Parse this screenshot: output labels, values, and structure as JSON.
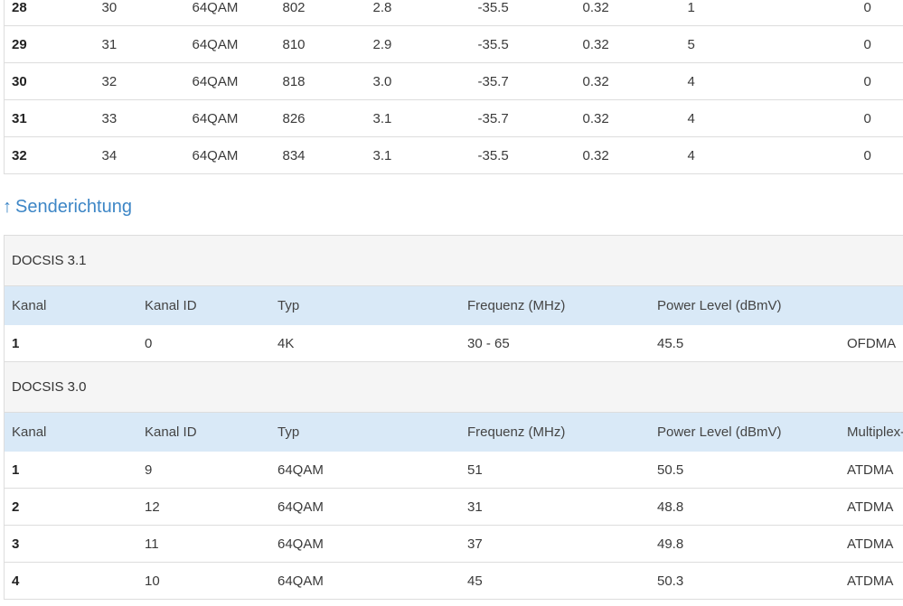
{
  "downstream": {
    "rows": [
      {
        "kanal": "28",
        "kanal_id": "30",
        "typ": "64QAM",
        "frequenz": "802",
        "power": "2.8",
        "mer": "-35.5",
        "latenz": "0.32",
        "korr": "1",
        "nicht_korr": "0"
      },
      {
        "kanal": "29",
        "kanal_id": "31",
        "typ": "64QAM",
        "frequenz": "810",
        "power": "2.9",
        "mer": "-35.5",
        "latenz": "0.32",
        "korr": "5",
        "nicht_korr": "0"
      },
      {
        "kanal": "30",
        "kanal_id": "32",
        "typ": "64QAM",
        "frequenz": "818",
        "power": "3.0",
        "mer": "-35.7",
        "latenz": "0.32",
        "korr": "4",
        "nicht_korr": "0"
      },
      {
        "kanal": "31",
        "kanal_id": "33",
        "typ": "64QAM",
        "frequenz": "826",
        "power": "3.1",
        "mer": "-35.7",
        "latenz": "0.32",
        "korr": "4",
        "nicht_korr": "0"
      },
      {
        "kanal": "32",
        "kanal_id": "34",
        "typ": "64QAM",
        "frequenz": "834",
        "power": "3.1",
        "mer": "-35.5",
        "latenz": "0.32",
        "korr": "4",
        "nicht_korr": "0"
      }
    ]
  },
  "upstream": {
    "title_arrow": "↑",
    "title": "Senderichtung",
    "docsis31": {
      "label": "DOCSIS 3.1",
      "headers": {
        "kanal": "Kanal",
        "kanal_id": "Kanal ID",
        "typ": "Typ",
        "frequenz": "Frequenz (MHz)",
        "power": "Power Level (dBmV)",
        "multiplex": ""
      },
      "rows": [
        {
          "kanal": "1",
          "kanal_id": "0",
          "typ": "4K",
          "frequenz": "30 - 65",
          "power": "45.5",
          "multiplex": "OFDMA"
        }
      ]
    },
    "docsis30": {
      "label": "DOCSIS 3.0",
      "headers": {
        "kanal": "Kanal",
        "kanal_id": "Kanal ID",
        "typ": "Typ",
        "frequenz": "Frequenz (MHz)",
        "power": "Power Level (dBmV)",
        "multiplex": "Multiplex-"
      },
      "rows": [
        {
          "kanal": "1",
          "kanal_id": "9",
          "typ": "64QAM",
          "frequenz": "51",
          "power": "50.5",
          "multiplex": "ATDMA"
        },
        {
          "kanal": "2",
          "kanal_id": "12",
          "typ": "64QAM",
          "frequenz": "31",
          "power": "48.8",
          "multiplex": "ATDMA"
        },
        {
          "kanal": "3",
          "kanal_id": "11",
          "typ": "64QAM",
          "frequenz": "37",
          "power": "49.8",
          "multiplex": "ATDMA"
        },
        {
          "kanal": "4",
          "kanal_id": "10",
          "typ": "64QAM",
          "frequenz": "45",
          "power": "50.3",
          "multiplex": "ATDMA"
        }
      ]
    }
  },
  "colors": {
    "accent": "#3d86c6",
    "header_bg": "#d9e9f7",
    "group_bg": "#f5f5f5",
    "border": "#dddddd"
  }
}
